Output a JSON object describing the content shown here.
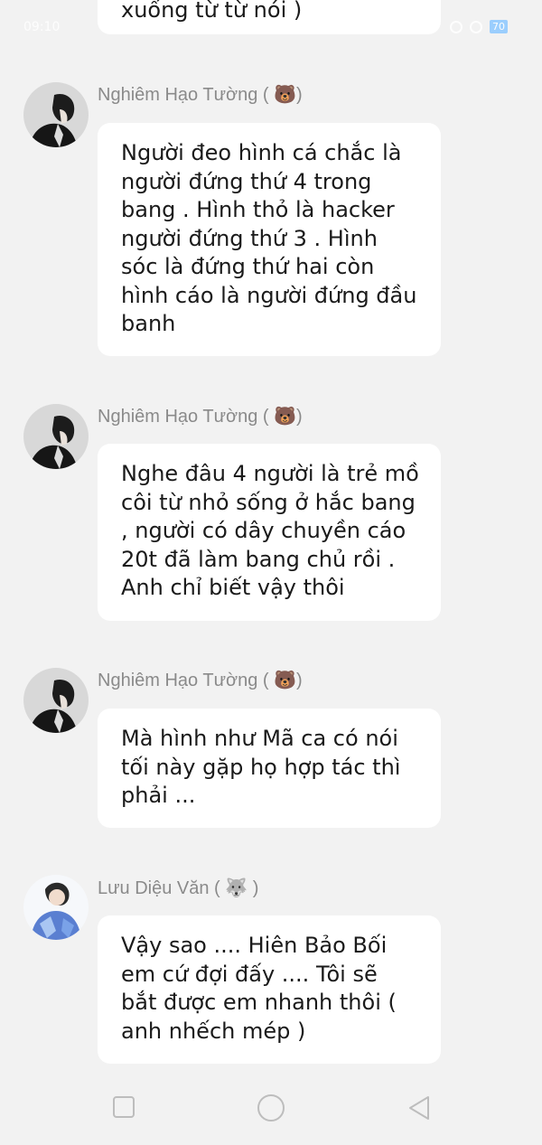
{
  "status_bar": {
    "time": "09:10",
    "battery": "70"
  },
  "top_bubble": {
    "text": "xuống từ từ nói )"
  },
  "messages": [
    {
      "sender": "Nghiêm Hạo Tường",
      "sender_emoji": "🐻",
      "text": "Người đeo hình cá chắc là người đứng thứ 4 trong bang . Hình thỏ là hacker người đứng thứ 3 . Hình sóc là đứng thứ hai còn hình cáo là người đứng đầu banh"
    },
    {
      "sender": "Nghiêm Hạo Tường",
      "sender_emoji": "🐻",
      "text": "Nghe đâu 4 người là trẻ mồ côi từ nhỏ sống ở hắc bang , người có dây chuyền cáo 20t đã làm bang chủ rồi . Anh chỉ biết vậy thôi"
    },
    {
      "sender": "Nghiêm Hạo Tường",
      "sender_emoji": "🐻",
      "text": "Mà hình như Mã ca có nói tối này gặp họ hợp tác thì phải ..."
    },
    {
      "sender": "Lưu Diệu Văn",
      "sender_emoji": "🐺",
      "text": "Vậy sao .... Hiên Bảo Bối em cứ đợi đấy .... Tôi sẽ bắt được em nhanh thôi ( anh nhếch mép )"
    }
  ],
  "nav": {
    "icons": [
      "square-icon",
      "circle-icon",
      "triangle-back-icon"
    ]
  }
}
